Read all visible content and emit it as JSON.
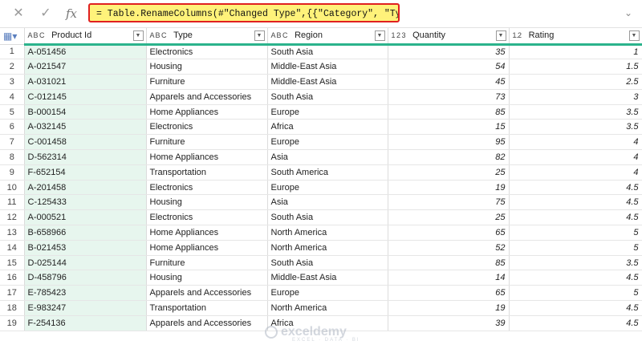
{
  "formula_bar": {
    "cancel_icon": "close-icon",
    "confirm_icon": "check-icon",
    "fx_label": "fx",
    "formula": "= Table.RenameColumns(#\"Changed Type\",{{\"Category\", \"Type\"}})"
  },
  "columns": [
    {
      "type_icon": "A B C",
      "label": "Product Id"
    },
    {
      "type_icon": "A B C",
      "label": "Type"
    },
    {
      "type_icon": "A B C",
      "label": "Region"
    },
    {
      "type_icon": "1 2 3",
      "label": "Quantity"
    },
    {
      "type_icon": "1.2",
      "label": "Rating"
    }
  ],
  "rows": [
    {
      "n": "1",
      "pid": "A-051456",
      "type": "Electronics",
      "region": "South Asia",
      "qty": "35",
      "rating": "1"
    },
    {
      "n": "2",
      "pid": "A-021547",
      "type": "Housing",
      "region": "Middle-East Asia",
      "qty": "54",
      "rating": "1.5"
    },
    {
      "n": "3",
      "pid": "A-031021",
      "type": "Furniture",
      "region": "Middle-East Asia",
      "qty": "45",
      "rating": "2.5"
    },
    {
      "n": "4",
      "pid": "C-012145",
      "type": "Apparels and Accessories",
      "region": "South Asia",
      "qty": "73",
      "rating": "3"
    },
    {
      "n": "5",
      "pid": "B-000154",
      "type": "Home Appliances",
      "region": "Europe",
      "qty": "85",
      "rating": "3.5"
    },
    {
      "n": "6",
      "pid": "A-032145",
      "type": "Electronics",
      "region": "Africa",
      "qty": "15",
      "rating": "3.5"
    },
    {
      "n": "7",
      "pid": "C-001458",
      "type": "Furniture",
      "region": "Europe",
      "qty": "95",
      "rating": "4"
    },
    {
      "n": "8",
      "pid": "D-562314",
      "type": "Home Appliances",
      "region": "Asia",
      "qty": "82",
      "rating": "4"
    },
    {
      "n": "9",
      "pid": "F-652154",
      "type": "Transportation",
      "region": "South America",
      "qty": "25",
      "rating": "4"
    },
    {
      "n": "10",
      "pid": "A-201458",
      "type": "Electronics",
      "region": "Europe",
      "qty": "19",
      "rating": "4.5"
    },
    {
      "n": "11",
      "pid": "C-125433",
      "type": "Housing",
      "region": "Asia",
      "qty": "75",
      "rating": "4.5"
    },
    {
      "n": "12",
      "pid": "A-000521",
      "type": "Electronics",
      "region": "South Asia",
      "qty": "25",
      "rating": "4.5"
    },
    {
      "n": "13",
      "pid": "B-658966",
      "type": "Home Appliances",
      "region": "North America",
      "qty": "65",
      "rating": "5"
    },
    {
      "n": "14",
      "pid": "B-021453",
      "type": "Home Appliances",
      "region": "North America",
      "qty": "52",
      "rating": "5"
    },
    {
      "n": "15",
      "pid": "D-025144",
      "type": "Furniture",
      "region": "South Asia",
      "qty": "85",
      "rating": "3.5"
    },
    {
      "n": "16",
      "pid": "D-458796",
      "type": "Housing",
      "region": "Middle-East Asia",
      "qty": "14",
      "rating": "4.5"
    },
    {
      "n": "17",
      "pid": "E-785423",
      "type": "Apparels and Accessories",
      "region": "Europe",
      "qty": "65",
      "rating": "5"
    },
    {
      "n": "18",
      "pid": "E-983247",
      "type": "Transportation",
      "region": "North America",
      "qty": "19",
      "rating": "4.5"
    },
    {
      "n": "19",
      "pid": "F-254136",
      "type": "Apparels and Accessories",
      "region": "Africa",
      "qty": "39",
      "rating": "4.5"
    }
  ],
  "watermark": {
    "name": "exceldemy",
    "tagline": "EXCEL · DATA · BI"
  },
  "colors": {
    "highlight_border": "#e02020",
    "highlight_fill": "#fff27a",
    "header_accent": "#2bb38c",
    "pid_column": "#e7f6ee"
  }
}
